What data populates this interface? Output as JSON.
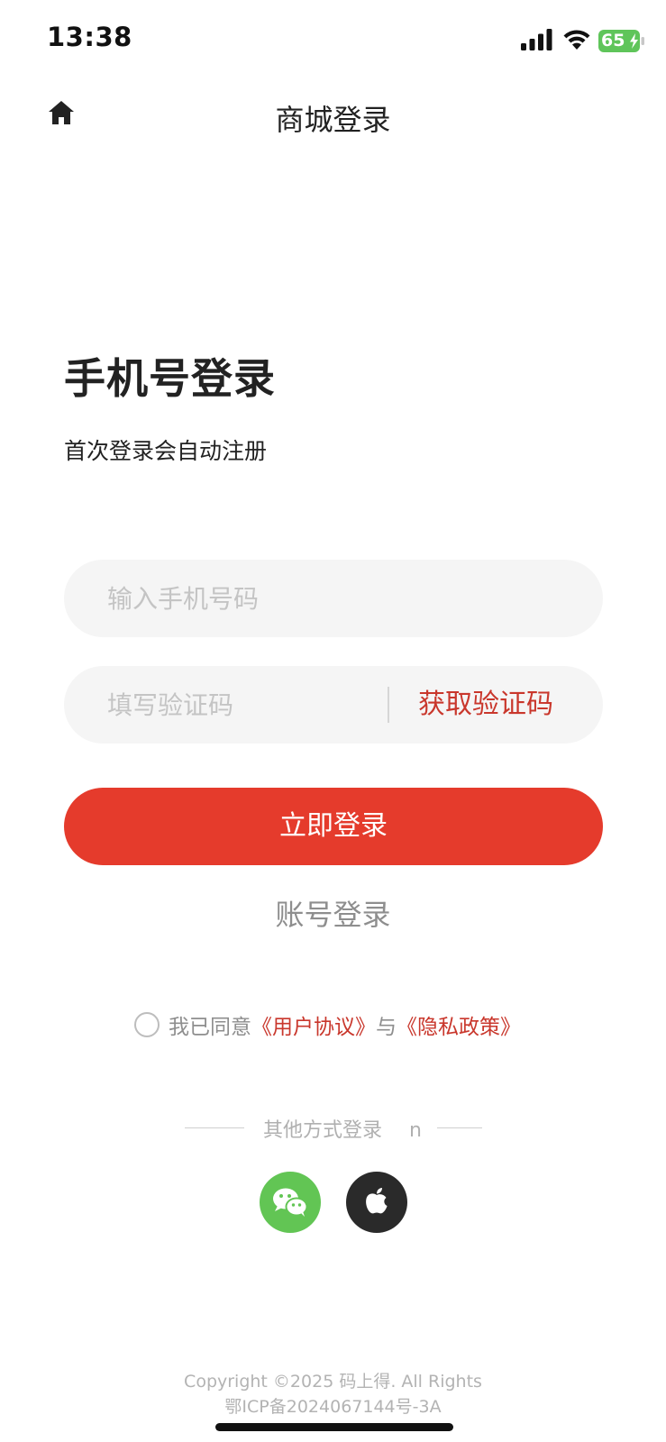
{
  "status_bar": {
    "time": "13:38",
    "battery": "65"
  },
  "nav": {
    "title": "商城登录",
    "home_icon": "home-icon"
  },
  "login": {
    "title": "手机号登录",
    "subtitle": "首次登录会自动注册",
    "phone_placeholder": "输入手机号码",
    "code_placeholder": "填写验证码",
    "get_code_label": "获取验证码",
    "submit_label": "立即登录",
    "account_login_label": "账号登录"
  },
  "agreement": {
    "prefix": "我已同意",
    "user_agreement": "《用户协议》",
    "connector": "与",
    "privacy_policy": "《隐私政策》"
  },
  "other_login": {
    "label": "其他方式登录",
    "stray_char": "n",
    "wechat_icon": "wechat-icon",
    "apple_icon": "apple-icon"
  },
  "footer": {
    "copyright": "Copyright ©2025 码上得. All Rights",
    "icp": "鄂ICP备2024067144号-3A"
  },
  "colors": {
    "accent": "#e53b2c",
    "link": "#c9372c",
    "wechat": "#62c554",
    "apple": "#2a2a2a",
    "field_bg": "#f5f5f5"
  }
}
